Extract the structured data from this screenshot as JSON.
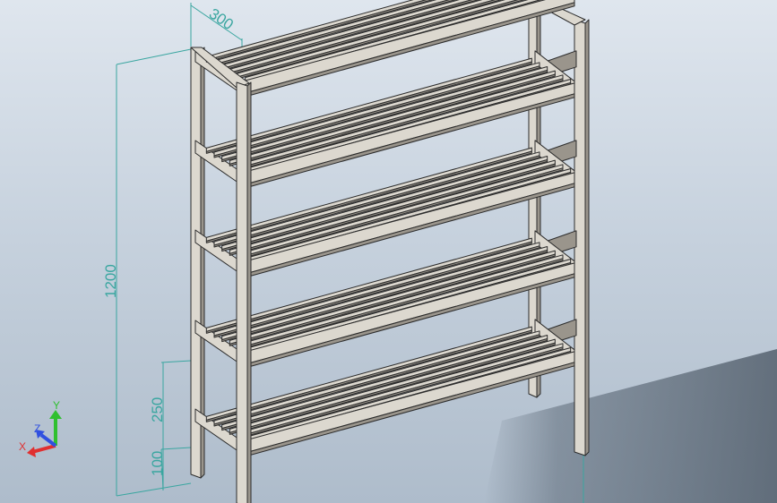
{
  "model": {
    "shelf_count": 5,
    "slats_per_shelf": 6
  },
  "dimensions": {
    "depth": "300",
    "height": "1200",
    "shelf_spacing": "250",
    "bottom_clearance": "100"
  },
  "triad": {
    "x_label": "X",
    "y_label": "Y",
    "z_label": "Z"
  },
  "colors": {
    "background_top": "#dfe6ee",
    "background_bottom": "#aebccb",
    "frame_face": "#dcd8cf",
    "frame_side": "#9a958c",
    "frame_edge": "#2c2c2c",
    "dimension": "#3aa6a0",
    "axis_x": "#e03030",
    "axis_y": "#30c030",
    "axis_z": "#3050e0"
  }
}
